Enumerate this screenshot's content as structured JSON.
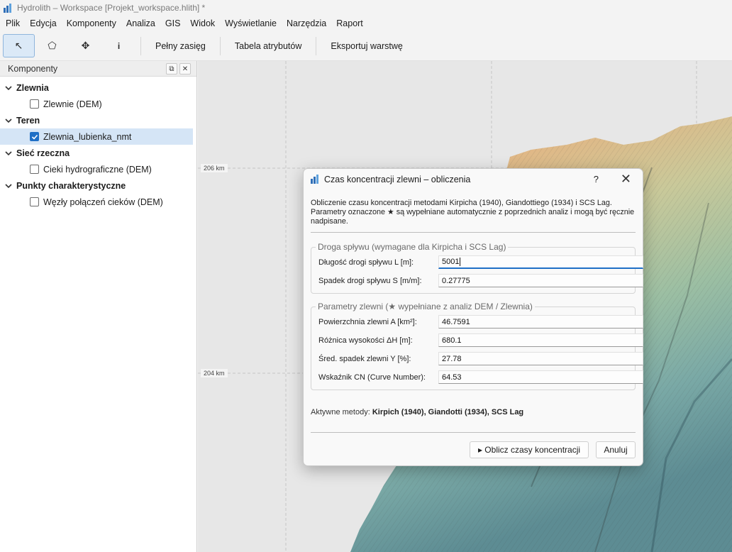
{
  "window": {
    "title": "Hydrolith – Workspace  [Projekt_workspace.hlith] *"
  },
  "menu": [
    "Plik",
    "Edycja",
    "Komponenty",
    "Analiza",
    "GIS",
    "Widok",
    "Wyświetlanie",
    "Narzędzia",
    "Raport"
  ],
  "toolbar": {
    "tools": [
      {
        "name": "select-tool",
        "glyph": "↖",
        "active": true
      },
      {
        "name": "polygon-tool",
        "glyph": "⬠",
        "active": false
      },
      {
        "name": "pan-tool",
        "glyph": "✥",
        "active": false
      },
      {
        "name": "info-tool",
        "glyph": "i",
        "active": false
      }
    ],
    "full_extent": "Pełny zasięg",
    "attribute_table": "Tabela atrybutów",
    "export_layer": "Eksportuj warstwę"
  },
  "panel": {
    "title": "Komponenty",
    "groups": [
      {
        "label": "Zlewnia",
        "items": [
          {
            "label": "Zlewnie (DEM)",
            "checked": false,
            "selected": false
          }
        ]
      },
      {
        "label": "Teren",
        "items": [
          {
            "label": "Zlewnia_lubienka_nmt",
            "checked": true,
            "selected": true
          }
        ]
      },
      {
        "label": "Sieć rzeczna",
        "items": [
          {
            "label": "Cieki hydrograficzne (DEM)",
            "checked": false,
            "selected": false
          }
        ]
      },
      {
        "label": "Punkty charakterystyczne",
        "items": [
          {
            "label": "Węzły połączeń cieków (DEM)",
            "checked": false,
            "selected": false
          }
        ]
      }
    ]
  },
  "map": {
    "coord_labels": [
      "206 km",
      "204 km"
    ]
  },
  "dialog": {
    "title": "Czas koncentracji zlewni – obliczenia",
    "help": "?",
    "close": "✕",
    "description_1": "Obliczenie czasu koncentracji metodami Kirpicha (1940), Giandottiego (1934) i SCS Lag.",
    "description_2": "Parametry oznaczone ★ są wypełniane automatycznie z poprzednich analiz i mogą być ręcznie nadpisane.",
    "flow_group": {
      "title": "Droga spływu (wymagane dla Kirpicha i SCS Lag)",
      "fields": [
        {
          "label": "Długość drogi spływu L [m]:",
          "value": "5001"
        },
        {
          "label": "Spadek drogi spływu S [m/m]:",
          "value": "0.27775"
        }
      ]
    },
    "basin_group": {
      "title": "Parametry zlewni (★ wypełniane z analiz DEM / Zlewnia)",
      "fields": [
        {
          "label": "Powierzchnia zlewni A [km²]:",
          "value": "46.7591"
        },
        {
          "label": "Różnica wysokości ΔH [m]:",
          "value": "680.1"
        },
        {
          "label": "Śred. spadek zlewni Y [%]:",
          "value": "27.78"
        },
        {
          "label": "Wskaźnik CN (Curve Number):",
          "value": "64.53"
        }
      ]
    },
    "active_methods_label": "Aktywne metody:",
    "active_methods_value": "Kirpich (1940), Giandotti (1934), SCS Lag",
    "compute_button": "▸ Oblicz czasy koncentracji",
    "cancel_button": "Anuluj"
  }
}
